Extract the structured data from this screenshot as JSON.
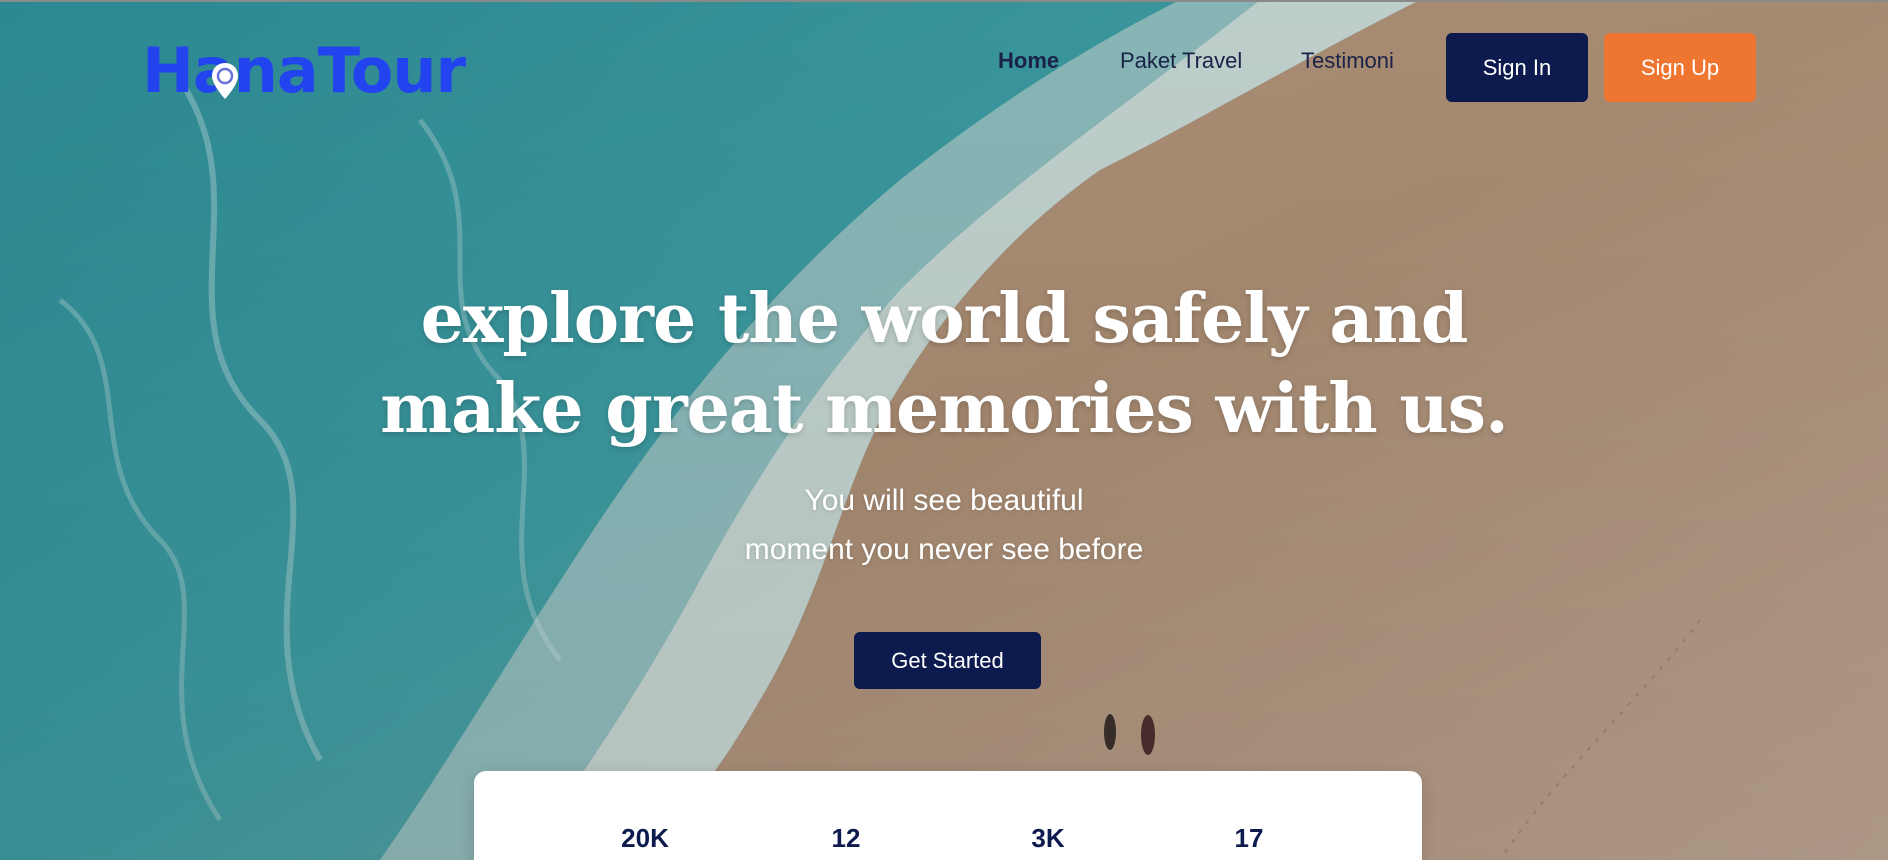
{
  "brand": {
    "logo_text": "HanaTour",
    "logo_color": "#2244ee"
  },
  "nav": {
    "items": [
      {
        "label": "Home",
        "active": true
      },
      {
        "label": "Paket Travel",
        "active": false
      },
      {
        "label": "Testimoni",
        "active": false
      }
    ],
    "sign_in_label": "Sign In",
    "sign_up_label": "Sign Up"
  },
  "hero": {
    "headline_line1": "explore the world safely and",
    "headline_line2": "make great memories with us.",
    "subtitle_line1": "You will see beautiful",
    "subtitle_line2": "moment you never see before",
    "cta_label": "Get Started"
  },
  "stats": {
    "values": [
      "20K",
      "12",
      "3K",
      "17"
    ]
  },
  "colors": {
    "primary_navy": "#0c1a4d",
    "accent_orange": "#ee7631",
    "text_white": "#ffffff"
  },
  "icons": {
    "logo_pin": "map-pin-icon"
  }
}
